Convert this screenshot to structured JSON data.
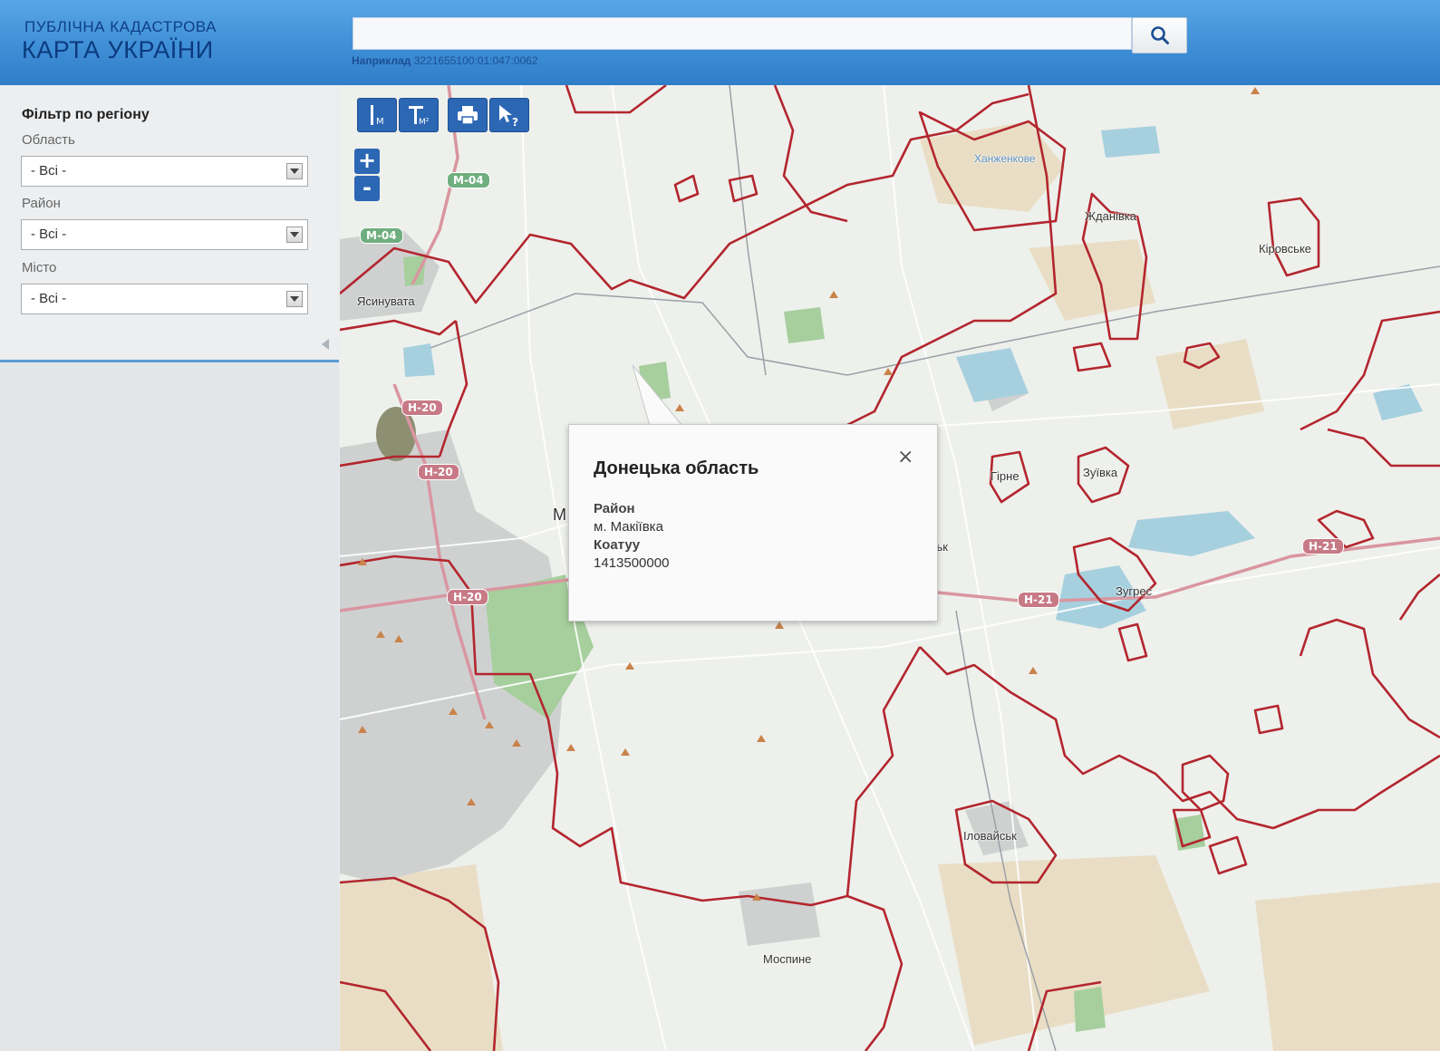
{
  "header": {
    "logo_line1": "ПУБЛІЧНА КАДАСТРОВА",
    "logo_line2": "КАРТА УКРАЇНИ",
    "search": {
      "value": "",
      "example_label": "Наприклад",
      "example_value": "3221655100:01:047:0062"
    },
    "search_icon": "search-icon"
  },
  "sidebar": {
    "title": "Фільтр по регіону",
    "fields": [
      {
        "label": "Область",
        "value": "- Всі -"
      },
      {
        "label": "Район",
        "value": "- Всі -"
      },
      {
        "label": "Місто",
        "value": "- Всі -"
      }
    ]
  },
  "map": {
    "tools": [
      {
        "name": "measure-distance",
        "icon": "ruler-m-icon"
      },
      {
        "name": "measure-area",
        "icon": "ruler-m2-icon"
      },
      {
        "name": "print",
        "icon": "printer-icon"
      },
      {
        "name": "identify",
        "icon": "cursor-question-icon"
      }
    ],
    "zoom": {
      "in": "+",
      "out": "-"
    },
    "place_labels": {
      "yasynuvata": "Ясинувата",
      "zhdanivka": "Жданівка",
      "kirovske": "Кіровське",
      "hirne": "Гірне",
      "zuivka": "Зуївка",
      "zuhres": "Зугрес",
      "ilovaisk": "Іловайськ",
      "mospyne": "Моспине",
      "m_letter": "М",
      "k_letter": "ськ",
      "reservoir": "Ханженкове"
    },
    "road_labels": {
      "m04_a": "М-04",
      "m04_b": "М-04",
      "h20_a": "Н-20",
      "h20_b": "Н-20",
      "h20_c": "Н-20",
      "h21_a": "Н-21",
      "h21_b": "Н-21"
    },
    "colors": {
      "boundary": "#b3262e",
      "water": "#a9d3e0",
      "forest": "#a8cf9a",
      "urban": "#cfcfcf",
      "agriculture": "#e9dcc2",
      "road_major": "#d99aa3"
    }
  },
  "popup": {
    "title": "Донецька область",
    "close": "×",
    "district_label": "Район",
    "district_value": "м. Макіївка",
    "koatuu_label": "Коатуу",
    "koatuu_value": "1413500000"
  }
}
